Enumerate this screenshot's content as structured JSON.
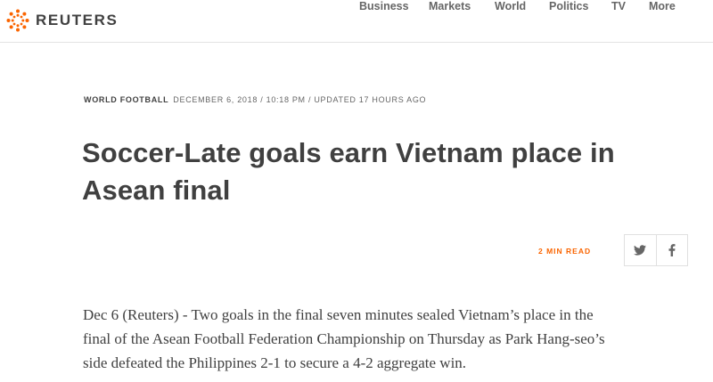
{
  "header": {
    "logo_text": "REUTERS",
    "nav": [
      {
        "label": "Business"
      },
      {
        "label": "Markets"
      },
      {
        "label": "World"
      },
      {
        "label": "Politics"
      },
      {
        "label": "TV"
      },
      {
        "label": "More"
      }
    ]
  },
  "article": {
    "section": "WORLD FOOTBALL",
    "date": "DECEMBER 6, 2018 / 10:18 PM / UPDATED 17 HOURS AGO",
    "title_line1": "Soccer-Late goals earn Vietnam place in",
    "title_line2": "Asean final",
    "read_time": "2 MIN READ",
    "share": {
      "twitter_icon": "twitter-icon",
      "facebook_icon": "facebook-icon"
    },
    "body_line1": "Dec 6 (Reuters) - Two goals in the final seven minutes sealed Vietnam’s place in the",
    "body_line2": "final of the Asean Football Federation Championship on Thursday as Park Hang-seo’s",
    "body_line3": "side defeated the Philippines 2-1 to secure a 4-2 aggregate win."
  },
  "colors": {
    "accent": "#fa6400",
    "text": "#404040",
    "muted": "#666666"
  }
}
